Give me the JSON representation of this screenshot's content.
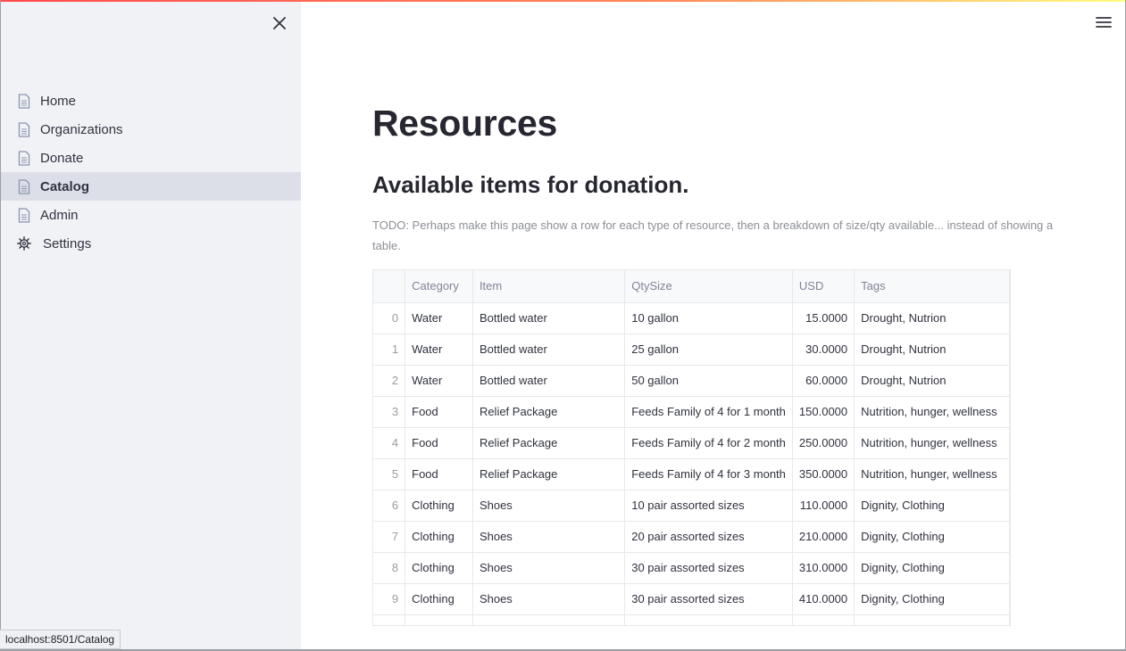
{
  "status_url": "localhost:8501/Catalog",
  "sidebar": {
    "items": [
      {
        "label": "Home",
        "icon": "page-icon",
        "active": false
      },
      {
        "label": "Organizations",
        "icon": "page-icon",
        "active": false
      },
      {
        "label": "Donate",
        "icon": "page-icon",
        "active": false
      },
      {
        "label": "Catalog",
        "icon": "page-icon",
        "active": true
      },
      {
        "label": "Admin",
        "icon": "page-icon",
        "active": false
      },
      {
        "label": "Settings",
        "icon": "gear-icon",
        "active": false
      }
    ]
  },
  "main": {
    "title": "Resources",
    "subtitle": "Available items for donation.",
    "todo": "TODO: Perhaps make this page show a row for each type of resource, then a breakdown of size/qty available... instead of showing a table."
  },
  "table": {
    "columns": [
      "",
      "Category",
      "Item",
      "QtySize",
      "USD",
      "Tags"
    ],
    "rows": [
      [
        "0",
        "Water",
        "Bottled water",
        "10 gallon",
        "15.0000",
        "Drought, Nutrion"
      ],
      [
        "1",
        "Water",
        "Bottled water",
        "25 gallon",
        "30.0000",
        "Drought, Nutrion"
      ],
      [
        "2",
        "Water",
        "Bottled water",
        "50 gallon",
        "60.0000",
        "Drought, Nutrion"
      ],
      [
        "3",
        "Food",
        "Relief Package",
        "Feeds Family of 4 for 1 month",
        "150.0000",
        "Nutrition, hunger, wellness"
      ],
      [
        "4",
        "Food",
        "Relief Package",
        "Feeds Family of 4 for 2 month",
        "250.0000",
        "Nutrition, hunger, wellness"
      ],
      [
        "5",
        "Food",
        "Relief Package",
        "Feeds Family of 4 for 3 month",
        "350.0000",
        "Nutrition, hunger, wellness"
      ],
      [
        "6",
        "Clothing",
        "Shoes",
        "10 pair assorted sizes",
        "110.0000",
        "Dignity, Clothing"
      ],
      [
        "7",
        "Clothing",
        "Shoes",
        "20 pair assorted sizes",
        "210.0000",
        "Dignity, Clothing"
      ],
      [
        "8",
        "Clothing",
        "Shoes",
        "30 pair assorted sizes",
        "310.0000",
        "Dignity, Clothing"
      ],
      [
        "9",
        "Clothing",
        "Shoes",
        "30 pair assorted sizes",
        "410.0000",
        "Dignity, Clothing"
      ]
    ]
  },
  "colors": {
    "sidebar_bg": "#f0f2f6",
    "active_item_bg": "#dcdfe8",
    "accent": "#ff4b4b",
    "icon": "#8b94ae"
  }
}
